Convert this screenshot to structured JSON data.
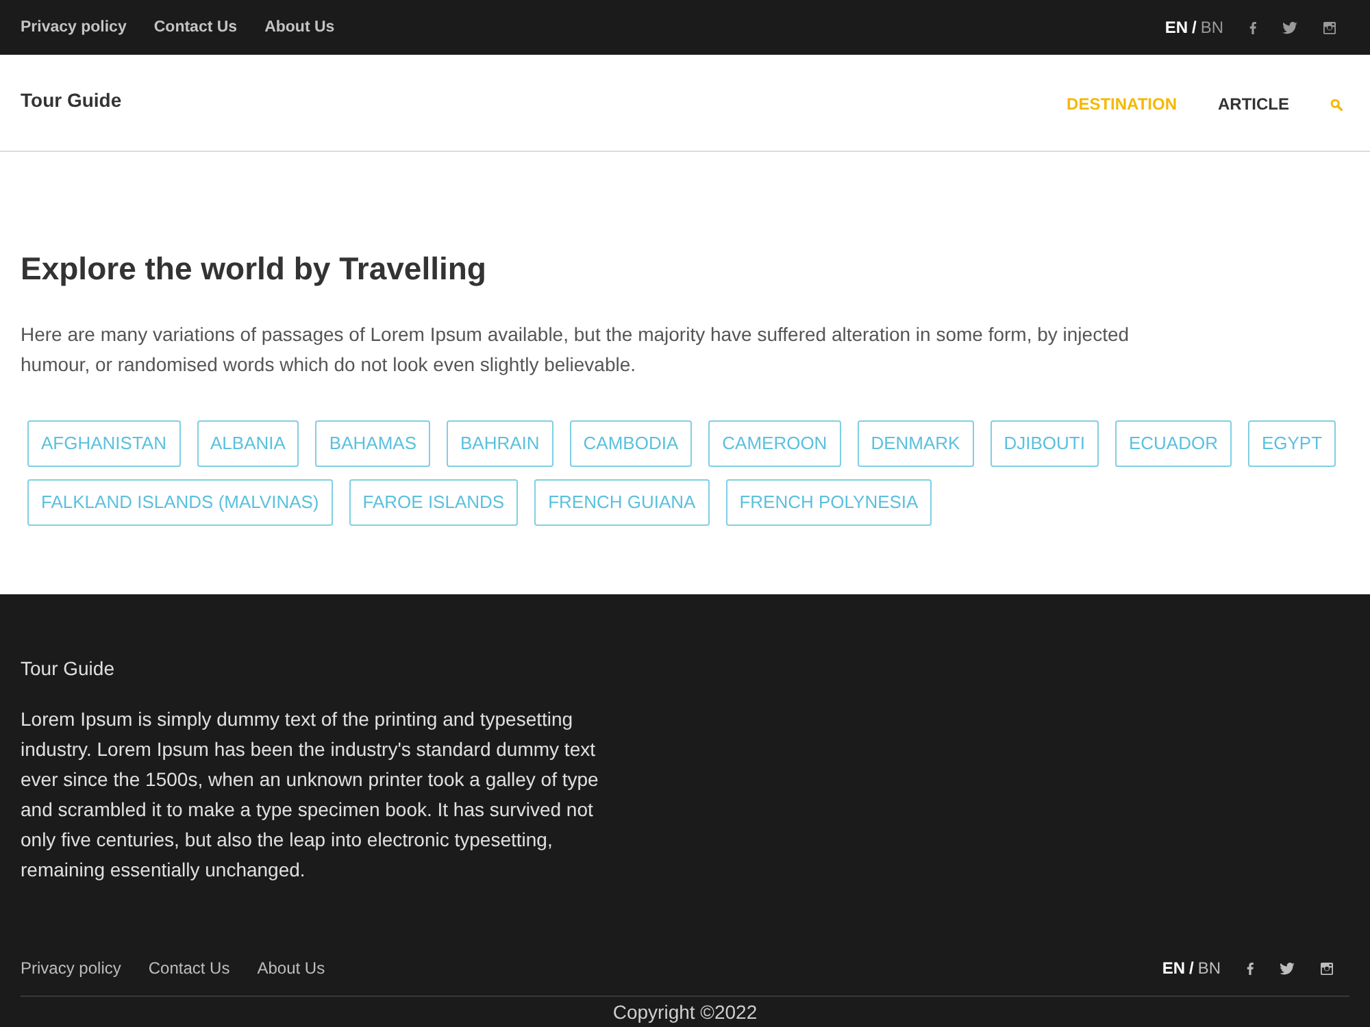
{
  "top_bar": {
    "links": [
      "Privacy policy",
      "Contact Us",
      "About Us"
    ],
    "languages": [
      {
        "label": "EN",
        "selected": true
      },
      {
        "label": "BN",
        "selected": false
      }
    ],
    "language_separator": "/"
  },
  "header": {
    "brand": "Tour Guide",
    "nav": [
      {
        "label": "DESTINATION",
        "selected": true
      },
      {
        "label": "ARTICLE",
        "selected": false
      }
    ]
  },
  "hero": {
    "title": "Explore the world by Travelling",
    "description": "Here are many variations of passages of Lorem Ipsum available, but the majority have suffered alteration in some form, by injected humour, or randomised words which do not look even slightly believable.",
    "countries": [
      "AFGHANISTAN",
      "ALBANIA",
      "BAHAMAS",
      "BAHRAIN",
      "CAMBODIA",
      "CAMEROON",
      "DENMARK",
      "DJIBOUTI",
      "ECUADOR",
      "EGYPT",
      "FALKLAND ISLANDS (MALVINAS)",
      "FAROE ISLANDS",
      "FRENCH GUIANA",
      "FRENCH POLYNESIA"
    ]
  },
  "footer": {
    "brand": "Tour Guide",
    "about": "Lorem Ipsum is simply dummy text of the printing and typesetting industry. Lorem Ipsum has been the industry's standard dummy text ever since the 1500s, when an unknown printer took a galley of type and scrambled it to make a type specimen book. It has survived not only five centuries, but also the leap into electronic typesetting, remaining essentially unchanged.",
    "links": [
      "Privacy policy",
      "Contact Us",
      "About Us"
    ],
    "languages": [
      {
        "label": "EN",
        "selected": true
      },
      {
        "label": "BN",
        "selected": false
      }
    ],
    "language_separator": "/",
    "copyright": "Copyright ©2022"
  }
}
